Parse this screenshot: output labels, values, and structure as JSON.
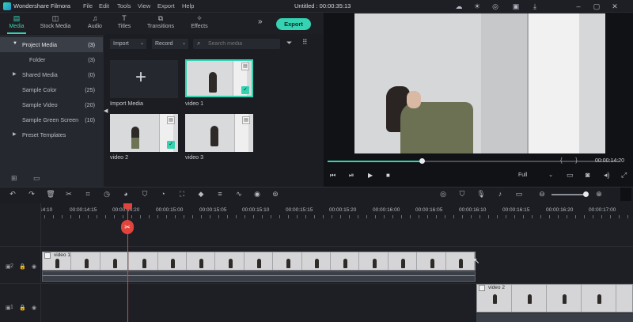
{
  "app": {
    "name": "Wondershare Filmora",
    "document_title": "Untitled : 00:00:35:13",
    "menu": [
      "File",
      "Edit",
      "Tools",
      "View",
      "Export",
      "Help"
    ]
  },
  "tabs": [
    {
      "label": "Media",
      "icon": "folder-icon",
      "active": true
    },
    {
      "label": "Stock Media",
      "icon": "stock-media-icon",
      "active": false
    },
    {
      "label": "Audio",
      "icon": "music-note-icon",
      "active": false
    },
    {
      "label": "Titles",
      "icon": "title-t-icon",
      "active": false
    },
    {
      "label": "Transitions",
      "icon": "transitions-icon",
      "active": false
    },
    {
      "label": "Effects",
      "icon": "effects-sparkle-icon",
      "active": false
    }
  ],
  "export_label": "Export",
  "library": {
    "items": [
      {
        "label": "Project Media",
        "count": "(3)",
        "expanded": true,
        "selected": true
      },
      {
        "label": "Folder",
        "count": "(3)"
      },
      {
        "label": "Shared Media",
        "count": "(0)"
      },
      {
        "label": "Sample Color",
        "count": "(25)"
      },
      {
        "label": "Sample Video",
        "count": "(20)"
      },
      {
        "label": "Sample Green Screen",
        "count": "(10)"
      },
      {
        "label": "Preset Templates",
        "count": ""
      }
    ]
  },
  "media_toolbar": {
    "import_label": "Import",
    "record_label": "Record",
    "search_placeholder": "Search media"
  },
  "media": {
    "import_label": "Import Media",
    "tiles": [
      {
        "label": "video 1",
        "checked": true
      },
      {
        "label": "video 2",
        "checked": true
      },
      {
        "label": "video 3",
        "checked": false
      }
    ]
  },
  "preview": {
    "time": "00:00:14:20",
    "progress_fraction": 0.32,
    "quality": "Full"
  },
  "timeline": {
    "ruler_labels": [
      "14:10",
      "00:00:14:15",
      "00:00:14:20",
      "00:00:15:00",
      "00:00:15:05",
      "00:00:15:10",
      "00:00:15:15",
      "00:00:15:20",
      "00:00:16:00",
      "00:00:16:05",
      "00:00:16:10",
      "00:00:16:15",
      "00:00:16:20",
      "00:00:17:00"
    ],
    "clips": [
      {
        "label": "video 1"
      },
      {
        "label": "video 2"
      }
    ],
    "track_numbers": [
      "2",
      "1"
    ]
  },
  "colors": {
    "accent": "#35d3b2",
    "playhead": "#e0443c",
    "background": "#1b1d22"
  }
}
